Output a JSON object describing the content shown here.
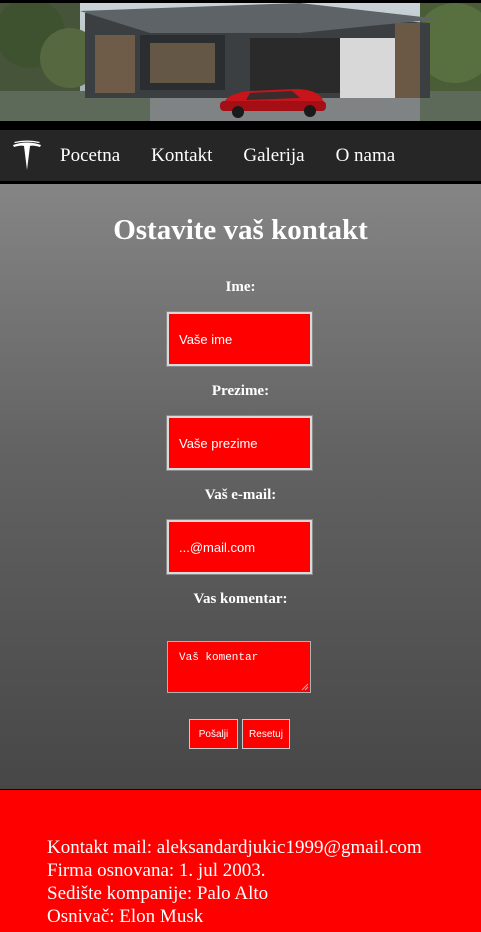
{
  "hero": {
    "image": "modern-house-with-red-car-photo"
  },
  "nav": {
    "logo": "tesla-logo",
    "items": [
      {
        "label": "Pocetna"
      },
      {
        "label": "Kontakt"
      },
      {
        "label": "Galerija"
      },
      {
        "label": "O nama"
      }
    ]
  },
  "form": {
    "title": "Ostavite vaš kontakt",
    "name_label": "Ime:",
    "name_placeholder": "Vaše ime",
    "surname_label": "Prezime:",
    "surname_placeholder": "Vaše prezime",
    "email_label": "Vaš e-mail:",
    "email_placeholder": "...@mail.com",
    "comment_label": "Vas komentar:",
    "comment_placeholder": "Vaš komentar",
    "submit_label": "Pošalji",
    "reset_label": "Resetuj"
  },
  "footer": {
    "lines": [
      "Kontakt mail: aleksandardjukic1999@gmail.com",
      "Firma osnovana: 1. jul 2003.",
      "Sedište kompanije: Palo Alto",
      "Osnivač: Elon Musk"
    ]
  },
  "colors": {
    "accent": "#ff0000",
    "nav_bg": "#262626",
    "gradient_top": "#858585",
    "gradient_bottom": "#474747"
  }
}
